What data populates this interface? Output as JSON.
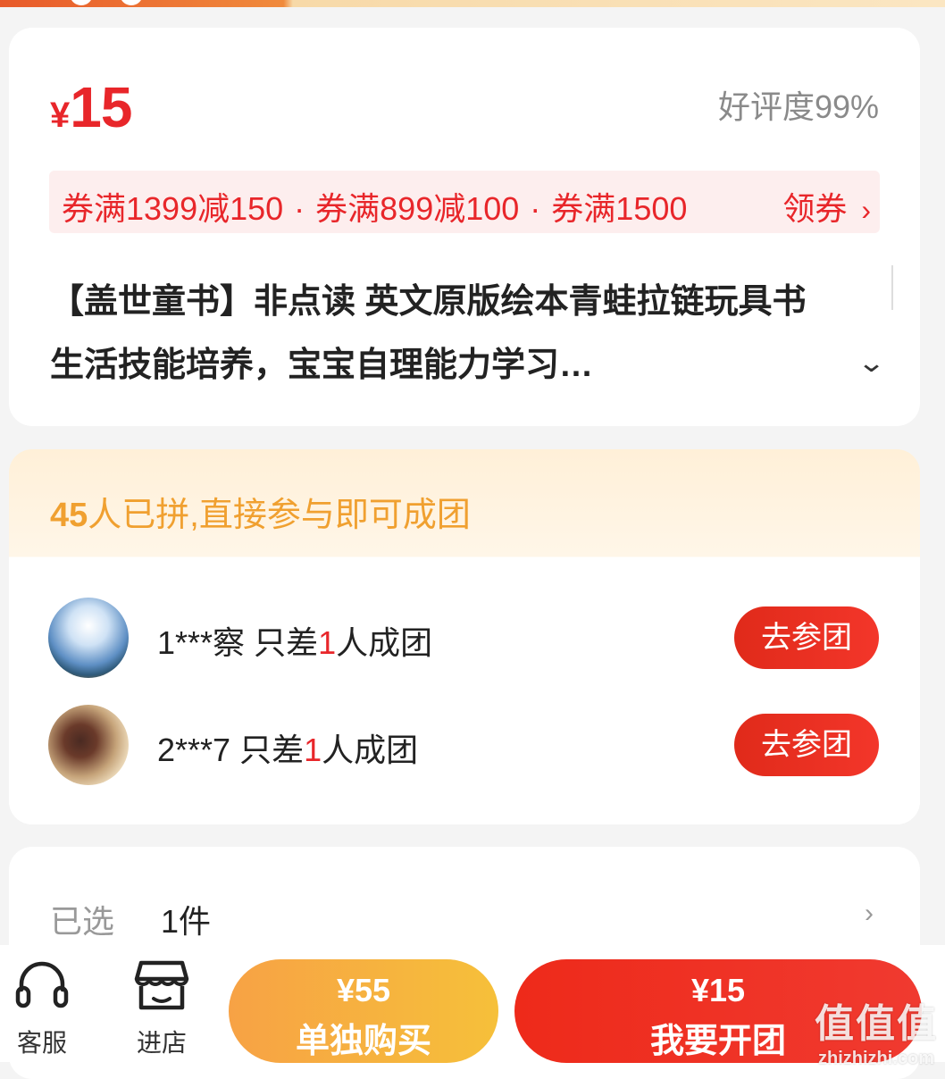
{
  "product": {
    "price_symbol": "¥",
    "price": "15",
    "rating": "好评度99%",
    "coupons": [
      "券满1399减150",
      "券满899减100",
      "券满1500"
    ],
    "coupon_separator": "·",
    "coupon_action": "领券",
    "title": "【盖世童书】非点读 英文原版绘本青蛙拉链玩具书生活技能培养，宝宝自理能力学习…"
  },
  "group_buy": {
    "count": "45",
    "headline_rest": "人已拼,直接参与即可成团",
    "rows": [
      {
        "user": "1***察",
        "prefix": "只差",
        "missing": "1",
        "suffix": "人成团",
        "action": "去参团"
      },
      {
        "user": "2***7",
        "prefix": "只差",
        "missing": "1",
        "suffix": "人成团",
        "action": "去参团"
      }
    ]
  },
  "selection": {
    "label": "已选",
    "value": "1件"
  },
  "bottom_bar": {
    "service_label": "客服",
    "shop_label": "进店",
    "buy_alone_price": "¥55",
    "buy_alone_label": "单独购买",
    "start_group_price": "¥15",
    "start_group_label": "我要开团"
  },
  "watermark": {
    "brand": "值值值",
    "domain": "zhizhizhi.com"
  },
  "colors": {
    "accent_red": "#e8262a",
    "group_orange": "#f0a030",
    "buy_alone_gradient": [
      "#f7a245",
      "#f6c03a"
    ],
    "start_group_gradient": [
      "#ee2a1a",
      "#f03a30"
    ]
  },
  "icons": {
    "service": "headset-icon",
    "shop": "store-icon",
    "coupon_more": "chevron-right-icon",
    "title_expand": "chevron-down-icon",
    "selection_more": "chevron-right-icon"
  }
}
